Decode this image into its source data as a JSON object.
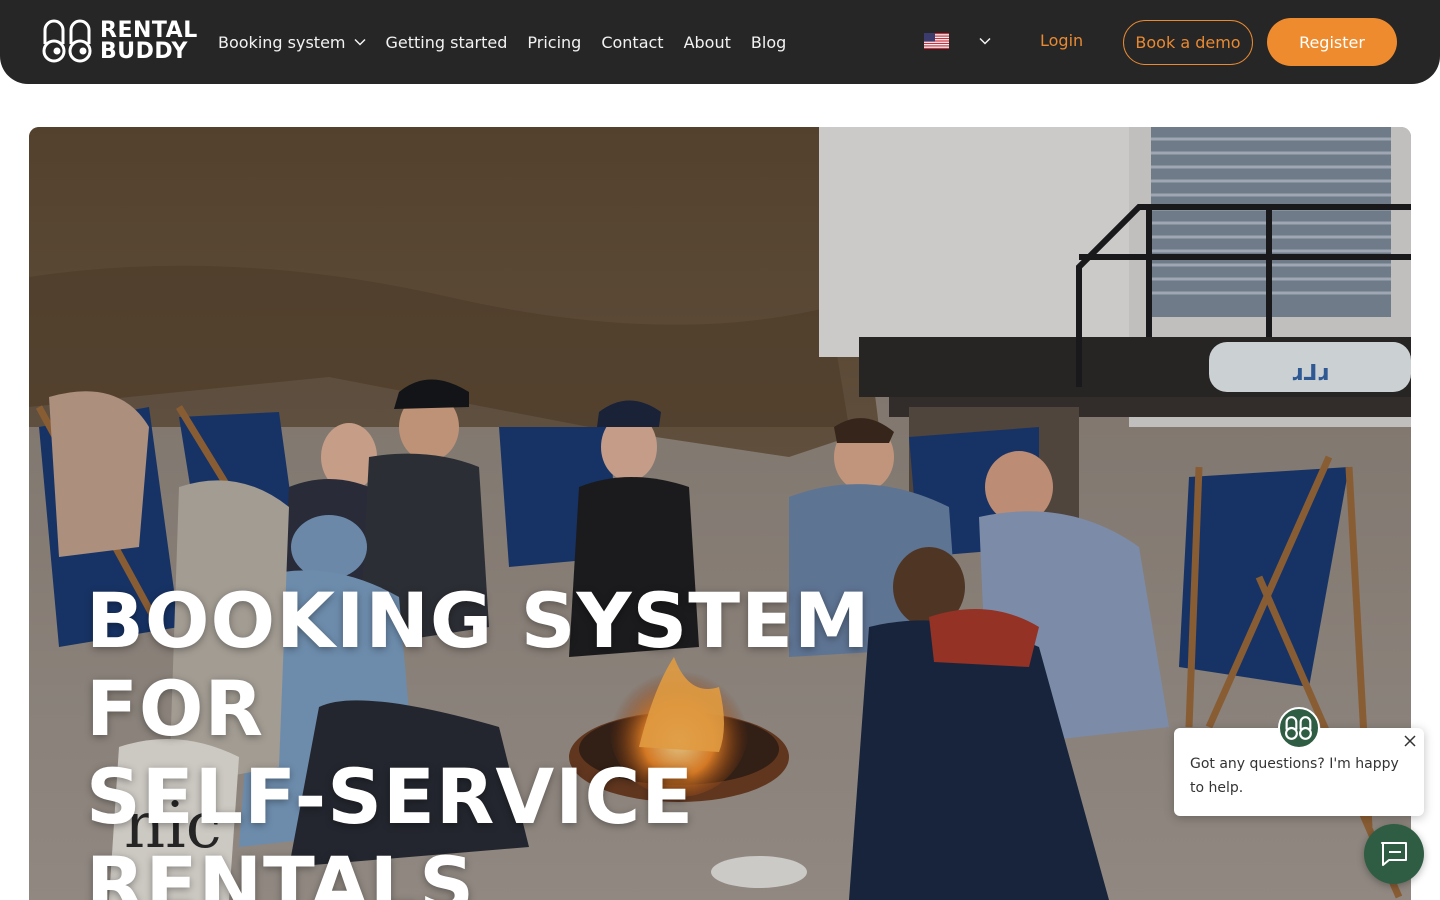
{
  "brand": {
    "line1": "RENTAL",
    "line2": "BUDDY",
    "logo_icon": "rental-buddy-logo"
  },
  "nav": {
    "items": [
      {
        "label": "Booking system",
        "has_dropdown": true
      },
      {
        "label": "Getting started"
      },
      {
        "label": "Pricing"
      },
      {
        "label": "Contact"
      },
      {
        "label": "About"
      },
      {
        "label": "Blog"
      }
    ],
    "language_icon": "us-flag-icon",
    "login": "Login",
    "book_demo": "Book a demo",
    "register": "Register"
  },
  "hero": {
    "title": "BOOKING SYSTEM FOR\nSELF-SERVICE RENTALS",
    "image": "group-around-campfire-on-beach-photo"
  },
  "chat": {
    "message": "Got any questions? I'm happy to help.",
    "close_icon": "close-icon",
    "launcher_icon": "chat-icon"
  },
  "colors": {
    "nav_bg": "#262626",
    "accent": "#ee8b2e",
    "chat_green": "#2e5d43"
  }
}
